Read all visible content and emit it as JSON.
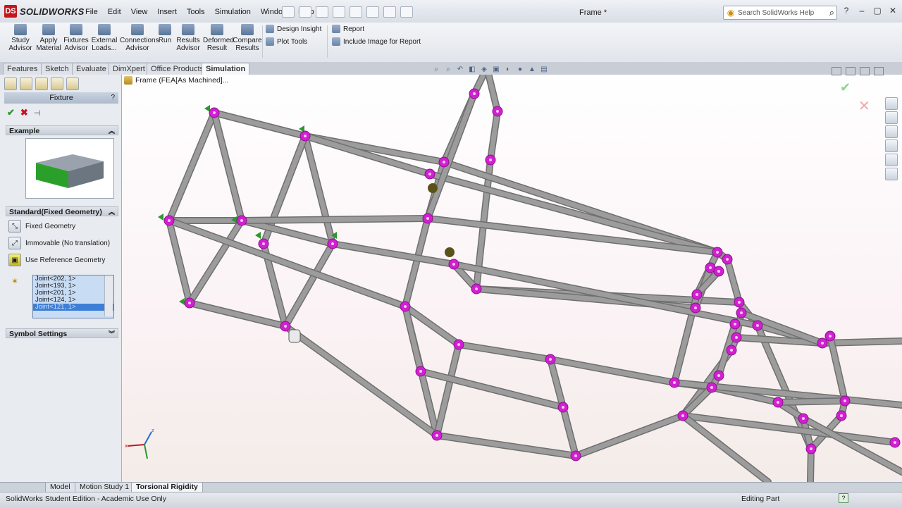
{
  "app": {
    "brand": "SOLIDWORKS",
    "logo_mark": "DS",
    "document_title": "Frame *"
  },
  "menu": [
    "File",
    "Edit",
    "View",
    "Insert",
    "Tools",
    "Simulation",
    "Window",
    "Help"
  ],
  "search": {
    "placeholder": "Search SolidWorks Help"
  },
  "command_manager": {
    "buttons": [
      {
        "label": "Study Advisor",
        "icon": "study-icon"
      },
      {
        "label": "Apply Material",
        "icon": "material-icon"
      },
      {
        "label": "Fixtures Advisor",
        "icon": "fixture-icon"
      },
      {
        "label": "External Loads...",
        "icon": "load-icon"
      },
      {
        "label": "Connections Advisor",
        "icon": "connection-icon"
      },
      {
        "label": "Run",
        "icon": "run-icon"
      },
      {
        "label": "Results Advisor",
        "icon": "results-icon"
      },
      {
        "label": "Deformed Result",
        "icon": "deform-icon"
      },
      {
        "label": "Compare Results",
        "icon": "compare-icon"
      }
    ],
    "small": [
      "Design Insight",
      "Plot Tools",
      "Report",
      "Include Image for Report"
    ]
  },
  "cm_tabs": [
    {
      "label": "Features",
      "active": false
    },
    {
      "label": "Sketch",
      "active": false
    },
    {
      "label": "Evaluate",
      "active": false
    },
    {
      "label": "DimXpert",
      "active": false
    },
    {
      "label": "Office Products",
      "active": false
    },
    {
      "label": "Simulation",
      "active": true
    }
  ],
  "property_manager": {
    "title": "Fixture",
    "help": "?",
    "example_heading": "Example",
    "standard_heading": "Standard(Fixed Geometry)",
    "options": [
      "Fixed Geometry",
      "Immovable (No translation)",
      "Use Reference Geometry"
    ],
    "selections": [
      "Joint<202, 1>",
      "Joint<193, 1>",
      "Joint<201, 1>",
      "Joint<124, 1>",
      "Joint<121, 1>"
    ],
    "symbol_heading": "Symbol Settings"
  },
  "viewport": {
    "breadcrumb": "Frame  (FEA[As Machined]...",
    "node_color": "#d21fd2",
    "fixed_node_color": "#5a5218",
    "fixture_color": "#2a9a2a",
    "member_color": "#9c9c9c"
  },
  "bottom_tabs": [
    {
      "label": "Model",
      "active": false
    },
    {
      "label": "Motion Study 1",
      "active": false
    },
    {
      "label": "Torsional Rigidity",
      "active": true
    }
  ],
  "status": {
    "left": "SolidWorks Student Edition - Academic Use Only",
    "right": "Editing Part",
    "help": "?"
  }
}
